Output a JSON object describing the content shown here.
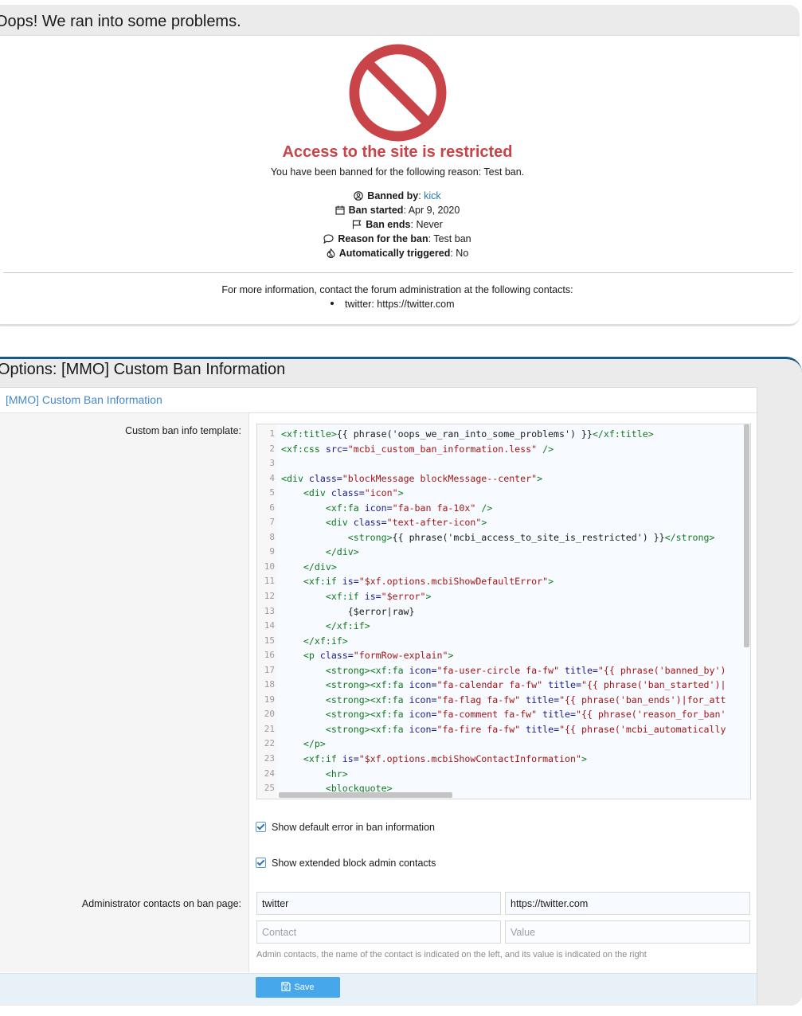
{
  "error_panel": {
    "title": "Oops! We ran into some problems.",
    "heading": "Access to the site is restricted",
    "reason_text": "You have been banned for the following reason: Test ban.",
    "details": [
      {
        "icon": "user-circle-icon",
        "label": "Banned by",
        "value": "kick",
        "is_link": true
      },
      {
        "icon": "calendar-icon",
        "label": "Ban started",
        "value": "Apr 9, 2020"
      },
      {
        "icon": "flag-icon",
        "label": "Ban ends",
        "value": "Never"
      },
      {
        "icon": "comment-icon",
        "label": "Reason for the ban",
        "value": "Test ban"
      },
      {
        "icon": "fire-icon",
        "label": "Automatically triggered",
        "value": "No"
      }
    ],
    "contact_intro": "For more information, contact the forum administration at the following contacts:",
    "contacts": [
      {
        "name": "twitter",
        "value": "https://twitter.com"
      }
    ],
    "accent_color": "#c84448"
  },
  "options_panel": {
    "title": "Options: [MMO] Custom Ban Information",
    "block_header": "[MMO] Custom Ban Information",
    "template_label": "Custom ban info template:",
    "code_lines": [
      "<xf:title>{{ phrase('oops_we_ran_into_some_problems') }}</xf:title>",
      "<xf:css src=\"mcbi_custom_ban_information.less\" />",
      "",
      "<div class=\"blockMessage blockMessage--center\">",
      "    <div class=\"icon\">",
      "        <xf:fa icon=\"fa-ban fa-10x\" />",
      "        <div class=\"text-after-icon\">",
      "            <strong>{{ phrase('mcbi_access_to_site_is_restricted') }}</strong>",
      "        </div>",
      "    </div>",
      "    <xf:if is=\"$xf.options.mcbiShowDefaultError\">",
      "        <xf:if is=\"$error\">",
      "            {$error|raw}",
      "        </xf:if>",
      "    </xf:if>",
      "    <p class=\"formRow-explain\">",
      "        <strong><xf:fa icon=\"fa-user-circle fa-fw\" title=\"{{ phrase('banned_by')",
      "        <strong><xf:fa icon=\"fa-calendar fa-fw\" title=\"{{ phrase('ban_started')|",
      "        <strong><xf:fa icon=\"fa-flag fa-fw\" title=\"{{ phrase('ban_ends')|for_att",
      "        <strong><xf:fa icon=\"fa-comment fa-fw\" title=\"{{ phrase('reason_for_ban'",
      "        <strong><xf:fa icon=\"fa-fire fa-fw\" title=\"{{ phrase('mcbi_automatically",
      "    </p>",
      "    <xf:if is=\"$xf.options.mcbiShowContactInformation\">",
      "        <hr>",
      "        <blockquote>"
    ],
    "checkboxes": [
      {
        "label": "Show default error in ban information",
        "checked": true
      },
      {
        "label": "Show extended block admin contacts",
        "checked": true
      }
    ],
    "contacts_label": "Administrator contacts on ban page:",
    "contact_rows": [
      {
        "name_value": "twitter",
        "value_value": "https://twitter.com"
      },
      {
        "name_placeholder": "Contact",
        "value_placeholder": "Value"
      }
    ],
    "contacts_hint": "Admin contacts, the name of the contact is indicated on the left, and its value is indicated on the right",
    "save_label": "Save",
    "button_color": "#47a7eb"
  }
}
